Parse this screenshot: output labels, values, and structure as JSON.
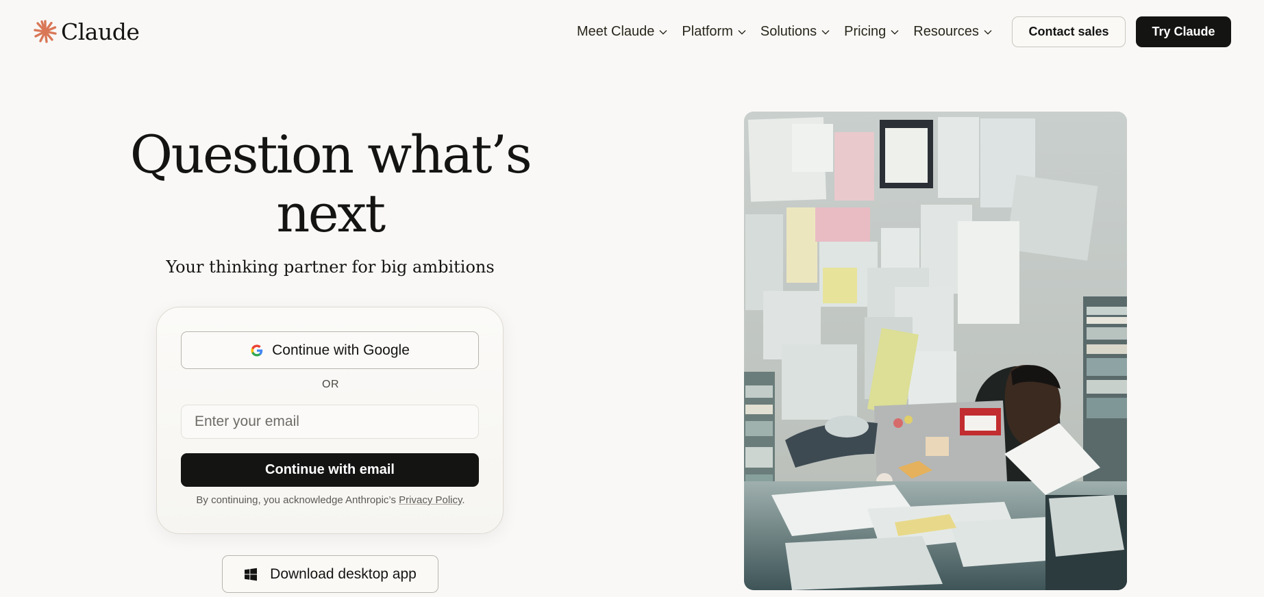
{
  "brand": {
    "name": "Claude",
    "accent_color": "#d97757"
  },
  "nav": {
    "items": [
      {
        "label": "Meet Claude"
      },
      {
        "label": "Platform"
      },
      {
        "label": "Solutions"
      },
      {
        "label": "Pricing"
      },
      {
        "label": "Resources"
      }
    ],
    "contact_label": "Contact sales",
    "try_label": "Try Claude"
  },
  "hero": {
    "title": "Question what’s next",
    "subtitle": "Your thinking partner for big ambitions"
  },
  "signup": {
    "google_label": "Continue with Google",
    "divider_label": "OR",
    "email_placeholder": "Enter your email",
    "email_value": "",
    "email_button_label": "Continue with email",
    "legal_prefix": "By continuing, you acknowledge Anthropic’s ",
    "legal_link": "Privacy Policy",
    "legal_suffix": "."
  },
  "download": {
    "label": "Download desktop app"
  },
  "icons": {
    "logo": "claude-spark-icon",
    "nav_dropdown": "chevron-down-icon",
    "google": "google-icon",
    "download": "windows-icon"
  }
}
